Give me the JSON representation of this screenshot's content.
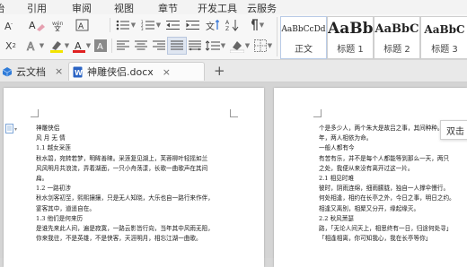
{
  "menu": [
    "始",
    "引用",
    "审阅",
    "视图",
    "章节",
    "开发工具",
    "云服务"
  ],
  "ribbon": {
    "x_label": "X",
    "font_color_letter": "A",
    "styles": [
      {
        "sample": "AaBbCcDd",
        "name": "正文"
      },
      {
        "sample": "AaBb",
        "name": "标题 1"
      },
      {
        "sample": "AaBbC",
        "name": "标题 2"
      },
      {
        "sample": "AaBbC",
        "name": "标题 3"
      }
    ]
  },
  "tabs": {
    "cloud_docs": "云文档",
    "document": "神雕侠侣.docx",
    "close_glyph": "×",
    "new_tab_glyph": "+"
  },
  "tooltip": "双击",
  "left_page": {
    "lines": [
      "神雕侠侣",
      "风 月 无 情",
      "1.1 越女采莲",
      "秋水碧，宛转若梦，明眸善睐。采莲复见湖上，芙蓉柳叶轻摇如兰",
      "  风风明月共浪流，弄着湖面，一只小舟荡漾，长歌一曲歌声在其间",
      "扁。",
      "1.2 一路初涉",
      "秋水剑客初至，熙熙攘攘，只是无人知晓，大乐也自一路行来作伴，",
      "宴客其中，道遥自在。",
      "1.3 他们是何来历",
      "是谁先来此人间，遍是寂寞，一路云影皆行向，当年其中风雨无阻，",
      "你来我往，不是英雄，不是侠客，天涯明月，相忘江湖一曲歌。"
    ]
  },
  "right_page": {
    "lines": [
      "个是多少人，两个朱大是故吕之事，其间种种。两种",
      "年，两人相依为命。",
      "  一般人都有今",
      "有苦有乐，并不是每个人都能等到那么一天，两只",
      "之处，我便从来没有离开过这一片。",
      "2.1 相见时难",
      "彼时，阴雨连绵，细雨朦胧，独自一人撑伞慢行。",
      "何处相逢，相约在长亭之外，今日之事，明日之约。",
      "相逢又离别，相聚又分开，缘起缘灭。",
      "2.2 秋风萧瑟",
      "路，「无论人间天上，相思终有一日，归途何处寻」",
      "「相逢相离，你可知我心，我在长亭等你」"
    ]
  }
}
